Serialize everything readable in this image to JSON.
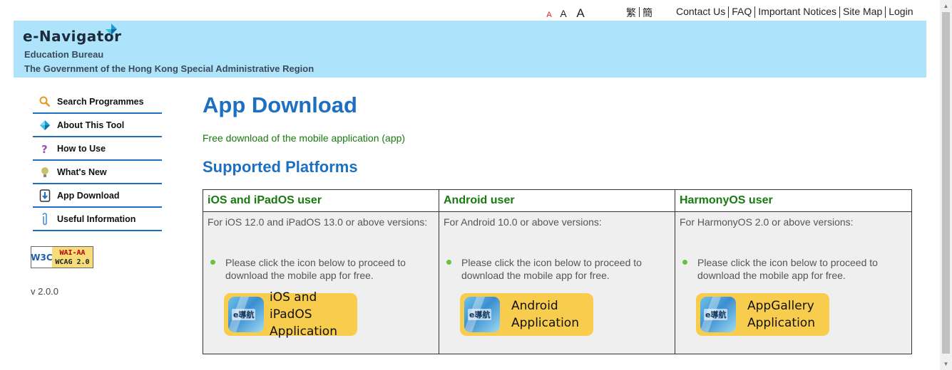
{
  "top": {
    "font_sizes": [
      "A",
      "A",
      "A"
    ],
    "languages": [
      "繁",
      "簡"
    ],
    "links": [
      "Contact Us",
      "FAQ",
      "Important Notices",
      "Site Map",
      "Login"
    ]
  },
  "header": {
    "logo": "e-Navigator",
    "dept": "Education Bureau",
    "government": "The Government of the Hong Kong Special Administrative Region"
  },
  "sidebar": {
    "items": [
      {
        "label": "Search Programmes",
        "icon": "search-icon"
      },
      {
        "label": "About This Tool",
        "icon": "logo-icon"
      },
      {
        "label": "How to Use",
        "icon": "question-icon"
      },
      {
        "label": "What's New",
        "icon": "lightbulb-icon"
      },
      {
        "label": "App Download",
        "icon": "download-icon"
      },
      {
        "label": "Useful Information",
        "icon": "paperclip-icon"
      }
    ],
    "badge_w3c": "W3C",
    "badge_line1": "WAI-AA",
    "badge_line2": "WCAG 2.0",
    "version": "v 2.0.0"
  },
  "main": {
    "title": "App Download",
    "intro": "Free download of the mobile application (app)",
    "subtitle": "Supported Platforms",
    "platforms": [
      {
        "header": "iOS and iPadOS user",
        "requirement": "For iOS 12.0 and iPadOS 13.0 or above versions:",
        "instruction": "Please click the icon below to proceed to download the mobile app for free.",
        "button_line1": "iOS and iPadOS",
        "button_line2": "Application",
        "icon_text": "e導航"
      },
      {
        "header": "Android user",
        "requirement": "For Android 10.0 or above versions:",
        "instruction": "Please click the icon below to proceed to download the mobile app for free.",
        "button_line1": "Android",
        "button_line2": "Application",
        "icon_text": "e導航"
      },
      {
        "header": "HarmonyOS user",
        "requirement": "For HarmonyOS 2.0 or above versions:",
        "instruction": "Please click the icon below to proceed to download the mobile app for free.",
        "button_line1": "AppGallery",
        "button_line2": "Application",
        "icon_text": "e導航"
      }
    ]
  },
  "colors": {
    "banner": "#aee4fb",
    "title_blue": "#1d6fc1",
    "green_text": "#177b0f",
    "button_yellow": "#f8cd4d",
    "nav_border": "#1e6fc2"
  }
}
